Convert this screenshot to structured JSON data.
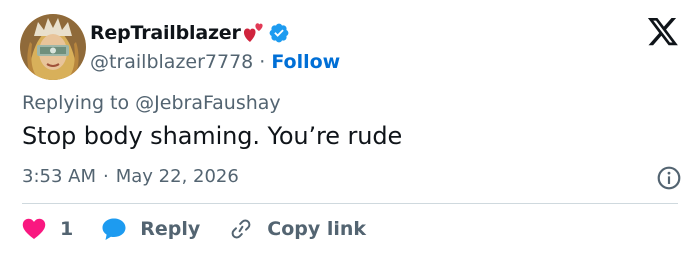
{
  "user": {
    "display_name": "RepTrailblazer",
    "handle": "@trailblazer7778",
    "separator": "·",
    "follow_label": "Follow"
  },
  "reply_context": "Replying to @JebraFaushay",
  "tweet": {
    "text": "Stop body shaming. You’re rude",
    "time": "3:53 AM",
    "separator": "·",
    "date": "May 22, 2026"
  },
  "actions": {
    "like_count": "1",
    "reply_label": "Reply",
    "copy_label": "Copy link"
  },
  "icons": {
    "logo": "x-logo-icon",
    "verified": "verified-badge-icon",
    "hearts": "two-hearts-emoji-icon",
    "info": "info-icon",
    "like": "heart-icon",
    "reply": "speech-bubble-icon",
    "copy": "link-icon"
  },
  "colors": {
    "text": "#0f1419",
    "secondary": "#536471",
    "accent": "#1d9bf0",
    "follow": "#006fd6",
    "like": "#f91880",
    "divider": "#cfd9de"
  }
}
